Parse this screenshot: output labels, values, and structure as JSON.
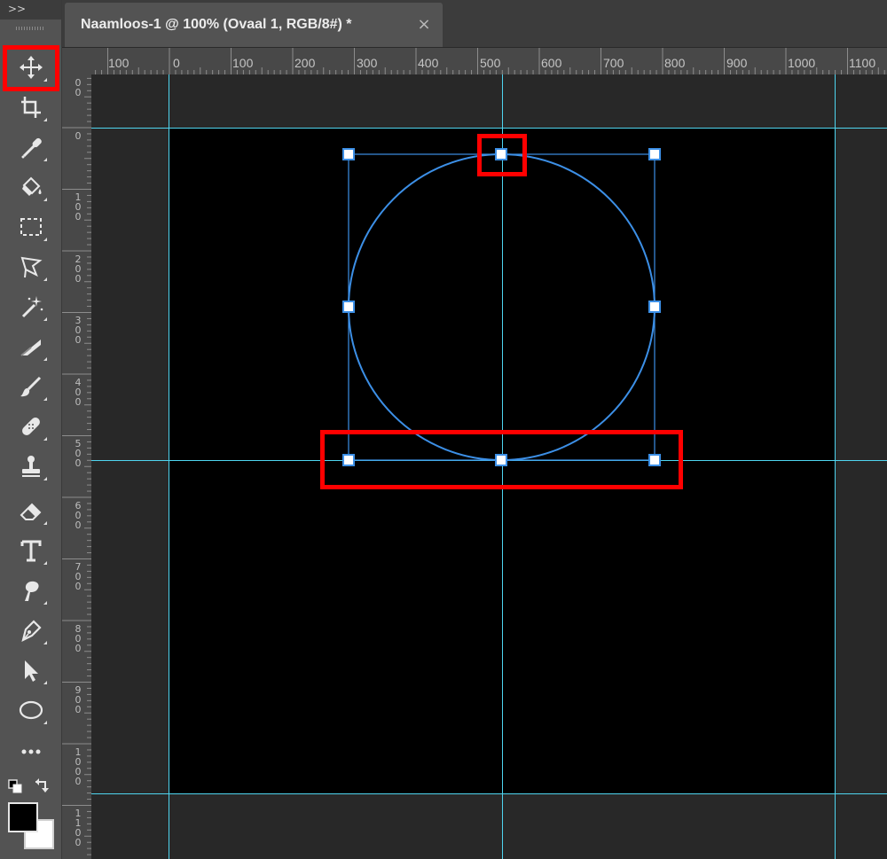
{
  "toolbar": {
    "collapse_label": ">>",
    "tools": [
      {
        "name": "move-tool",
        "icon": "move-icon",
        "selected": true
      },
      {
        "name": "crop-tool",
        "icon": "crop-icon"
      },
      {
        "name": "eyedropper-tool",
        "icon": "eyedropper-icon"
      },
      {
        "name": "paint-bucket-tool",
        "icon": "paint-bucket-icon"
      },
      {
        "name": "rectangular-marquee-tool",
        "icon": "marquee-icon"
      },
      {
        "name": "polygonal-lasso-tool",
        "icon": "lasso-icon"
      },
      {
        "name": "magic-wand-tool",
        "icon": "magic-wand-icon"
      },
      {
        "name": "gradient-tool",
        "icon": "gradient-icon"
      },
      {
        "name": "brush-tool",
        "icon": "brush-icon"
      },
      {
        "name": "healing-brush-tool",
        "icon": "bandage-icon"
      },
      {
        "name": "clone-stamp-tool",
        "icon": "stamp-icon"
      },
      {
        "name": "eraser-tool",
        "icon": "eraser-icon"
      },
      {
        "name": "type-tool",
        "icon": "type-icon"
      },
      {
        "name": "smudge-tool",
        "icon": "smudge-icon"
      },
      {
        "name": "pen-tool",
        "icon": "pen-icon"
      },
      {
        "name": "path-selection-tool",
        "icon": "arrow-icon"
      },
      {
        "name": "ellipse-tool",
        "icon": "ellipse-icon"
      },
      {
        "name": "more-tools",
        "icon": "more-icon"
      }
    ],
    "foreground_color": "#000000",
    "background_color": "#ffffff"
  },
  "document_tab": {
    "title": "Naamloos-1 @ 100% (Ovaal 1, RGB/8#) *",
    "close_label": "×"
  },
  "rulers": {
    "top_labels": [
      "100",
      "0",
      "100",
      "200",
      "300",
      "400",
      "500",
      "600",
      "700",
      "800",
      "900",
      "1000",
      "1100"
    ],
    "left_labels": [
      "0\n0",
      "0",
      "1\n0\n0",
      "2\n0\n0",
      "3\n0\n0",
      "4\n0\n0",
      "5\n0\n0",
      "6\n0\n0",
      "7\n0\n0",
      "8\n0\n0",
      "9\n0\n0",
      "1\n0\n0\n0",
      "1\n1\n0\n0"
    ]
  },
  "canvas": {
    "document_color": "#000000",
    "pasteboard_color": "#282828",
    "guide_color": "#4fd5f0",
    "path_color": "#3c8fe6",
    "highlight_color": "#ff0000"
  }
}
